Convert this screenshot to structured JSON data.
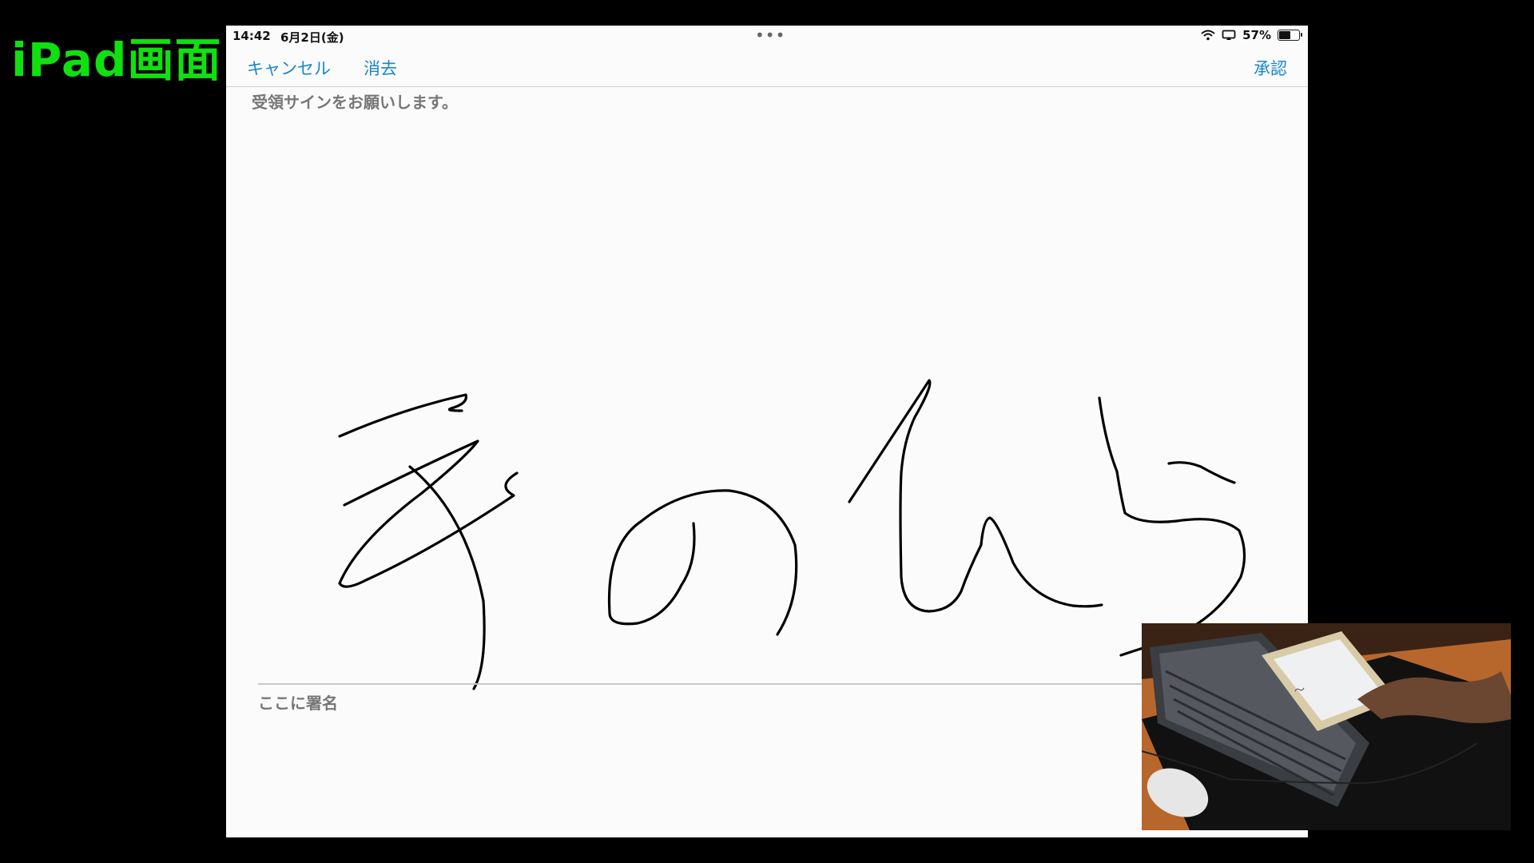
{
  "overlay": {
    "label": "iPad画面"
  },
  "status_bar": {
    "time": "14:42",
    "date": "6月2日(金)",
    "dots": "•••",
    "battery": "57%",
    "battery_level": 0.57
  },
  "nav": {
    "cancel_label": "キャンセル",
    "clear_label": "消去",
    "approve_label": "承認",
    "accent_color": "#1a86c8"
  },
  "signature": {
    "instruction": "受領サインをお願いします。",
    "sign_here": "ここに署名",
    "ink_color": "#000000"
  },
  "inset": {
    "icons": [
      "keyboard-icon",
      "mouse-icon",
      "tablet-icon"
    ]
  }
}
